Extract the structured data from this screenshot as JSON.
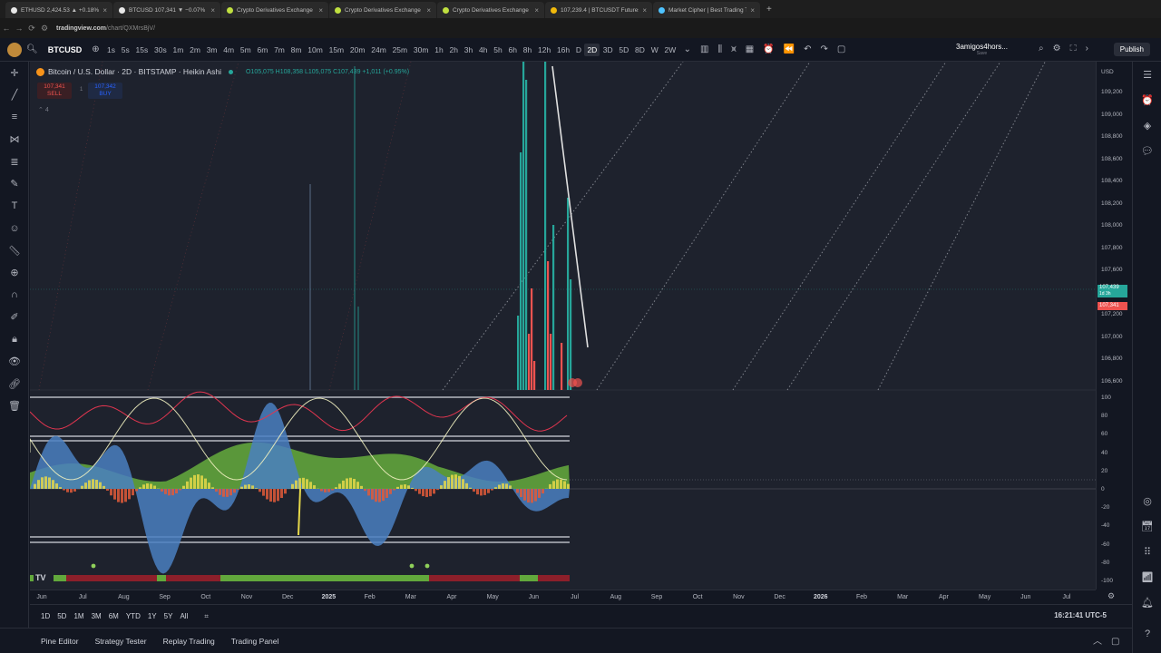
{
  "browser": {
    "tabs": [
      {
        "label": "ETHUSD 2,424.53 ▲ +0.18% 3ʏ",
        "color": "#e8e8e8"
      },
      {
        "label": "BTCUSD 107,341 ▼ −0.07% 3ʏ",
        "color": "#e8e8e8"
      },
      {
        "label": "Crypto Derivatives Exchange | E",
        "color": "#c0e040"
      },
      {
        "label": "Crypto Derivatives Exchange | E",
        "color": "#c0e040"
      },
      {
        "label": "Crypto Derivatives Exchange | E",
        "color": "#c0e040"
      },
      {
        "label": "107,239.4 | BTCUSDT Futures B",
        "color": "#f0b90b"
      },
      {
        "label": "Market Cipher | Best Trading T",
        "color": "#4ec3ff"
      }
    ],
    "url_domain": "tradingview.com",
    "url_path": "/chart/QXMrsBjV/"
  },
  "toolbar": {
    "symbol": "BTCUSD",
    "timeframes": [
      "1s",
      "5s",
      "15s",
      "30s",
      "1m",
      "2m",
      "3m",
      "4m",
      "5m",
      "6m",
      "7m",
      "8m",
      "10m",
      "15m",
      "20m",
      "24m",
      "25m",
      "30m",
      "1h",
      "2h",
      "3h",
      "4h",
      "5h",
      "6h",
      "8h",
      "12h",
      "16h",
      "D",
      "2D",
      "3D",
      "5D",
      "8D",
      "W",
      "2W"
    ],
    "active_timeframe": "2D",
    "account": "3amigos4hors...",
    "account_sub": "Save",
    "publish_label": "Publish"
  },
  "legend": {
    "title": "Bitcoin / U.S. Dollar · 2D · BITSTAMP · Heikin Ashi",
    "ohlc": "O105,075  H108,358  L105,075  C107,439  +1,011 (+0.95%)",
    "sell_price": "107,341",
    "sell_label": "SELL",
    "buy_price": "107,342",
    "buy_label": "BUY",
    "spread": "1",
    "collapsed_count": "4"
  },
  "price_axis": {
    "currency": "USD",
    "ticks": [
      "109,200",
      "109,000",
      "108,800",
      "108,600",
      "108,400",
      "108,200",
      "108,000",
      "107,800",
      "107,600",
      "107,400",
      "107,200",
      "107,000",
      "106,800",
      "106,600"
    ],
    "current_price": "107,439",
    "current_countdown": "1d 3h",
    "bid_price": "107,341"
  },
  "oscillator_axis": {
    "ticks": [
      "100",
      "80",
      "60",
      "40",
      "20",
      "0",
      "-20",
      "-40",
      "-60",
      "-80",
      "-100"
    ]
  },
  "time_axis": {
    "ticks": [
      "Jun",
      "Jul",
      "Aug",
      "Sep",
      "Oct",
      "Nov",
      "Dec",
      "2025",
      "Feb",
      "Mar",
      "Apr",
      "May",
      "Jun",
      "Jul",
      "Aug",
      "Sep",
      "Oct",
      "Nov",
      "Dec",
      "2026",
      "Feb",
      "Mar",
      "Apr",
      "May",
      "Jun",
      "Jul"
    ]
  },
  "range_bar": {
    "ranges": [
      "1D",
      "5D",
      "1M",
      "3M",
      "6M",
      "YTD",
      "1Y",
      "5Y",
      "All"
    ],
    "clock": "16:21:41 UTC-5"
  },
  "bottom_tabs": [
    "Pine Editor",
    "Strategy Tester",
    "Replay Trading",
    "Trading Panel"
  ],
  "colors": {
    "bg": "#131722",
    "chart_bg": "#1e222d",
    "up": "#26a69a",
    "down": "#ef5350",
    "osc_blue": "#4a7fc1",
    "osc_green": "#6fbf3f",
    "osc_yellow": "#e6d84a"
  },
  "icons": {
    "left": [
      "cursor-icon",
      "trend-line-icon",
      "fib-icon",
      "pattern-icon",
      "projection-icon",
      "brush-icon",
      "text-icon",
      "emoji-icon",
      "ruler-icon",
      "zoom-icon",
      "magnet-icon",
      "lock-drawing-icon",
      "lock-icon",
      "eye-icon",
      "link-icon",
      "trash-icon"
    ],
    "right": [
      "watchlist-icon",
      "alerts-icon",
      "layers-icon",
      "chat-icon",
      "target-icon",
      "calendar-icon",
      "apps-icon",
      "signal-icon",
      "notifications-icon",
      "help-icon"
    ]
  }
}
